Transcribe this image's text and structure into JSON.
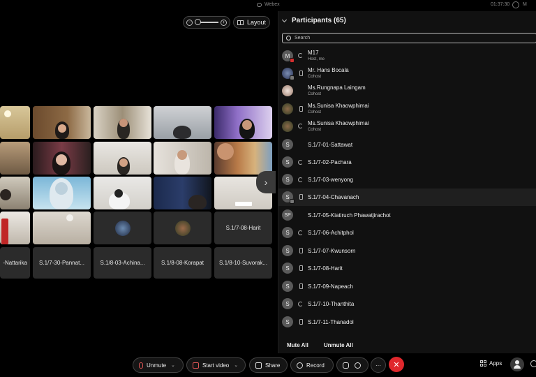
{
  "topbar": {
    "app_title": "Webex",
    "clock": "01:37:30",
    "mini_label": "M"
  },
  "stage": {
    "layout_label": "Layout",
    "zoom_minus": "−",
    "zoom_plus": "+",
    "name_tiles": [
      "S.1/7-08-Harit",
      "-Nattarika",
      "S.1/7-30-Pannat...",
      "S.1/8-03-Achina...",
      "S.1/8-08-Korapat",
      "S.1/8-10-Suvorak..."
    ],
    "next_arrow": "›"
  },
  "panel": {
    "title": "Participants (65)",
    "search_placeholder": "Search",
    "participants": [
      {
        "initial": "M",
        "name": "M17",
        "role": "Host, me"
      },
      {
        "initial": "",
        "name": "Mr. Hans Bocala",
        "role": "Cohost"
      },
      {
        "initial": "",
        "name": "Ms.Rungnapa Laingam",
        "role": "Cohost"
      },
      {
        "initial": "",
        "name": "Ms.Sunisa Khaowphimai",
        "role": "Cohost"
      },
      {
        "initial": "",
        "name": "Ms.Sunisa Khaowphimai",
        "role": "Cohost"
      },
      {
        "initial": "S",
        "name": "S.1/7-01-Sattawat",
        "role": ""
      },
      {
        "initial": "S",
        "name": "S.1/7-02-Pachara",
        "role": ""
      },
      {
        "initial": "S",
        "name": "S.1/7-03-wenyong",
        "role": ""
      },
      {
        "initial": "S",
        "name": "S.1/7-04-Chavanach",
        "role": ""
      },
      {
        "initial": "SP",
        "name": "S.1/7-05-Kiatiruch Phawatjirachot",
        "role": ""
      },
      {
        "initial": "S",
        "name": "S.1/7-06-Achitphol",
        "role": ""
      },
      {
        "initial": "S",
        "name": "S.1/7-07-Kwunsorn",
        "role": ""
      },
      {
        "initial": "S",
        "name": "S.1/7-08-Harit",
        "role": ""
      },
      {
        "initial": "S",
        "name": "S.1/7-09-Napeach",
        "role": ""
      },
      {
        "initial": "S",
        "name": "S.1/7-10-Thanthita",
        "role": ""
      },
      {
        "initial": "S",
        "name": "S.1/7-11-Thanadol",
        "role": ""
      }
    ],
    "mute_all": "Mute All",
    "unmute_all": "Unmute All"
  },
  "toolbar": {
    "unmute": "Unmute",
    "start_video": "Start video",
    "share": "Share",
    "record": "Record",
    "more": "···",
    "end": "✕",
    "apps": "Apps"
  },
  "colors": {
    "end_call": "#e0282d",
    "panel_bg": "#111111",
    "host_badge": "#d32f2f"
  }
}
